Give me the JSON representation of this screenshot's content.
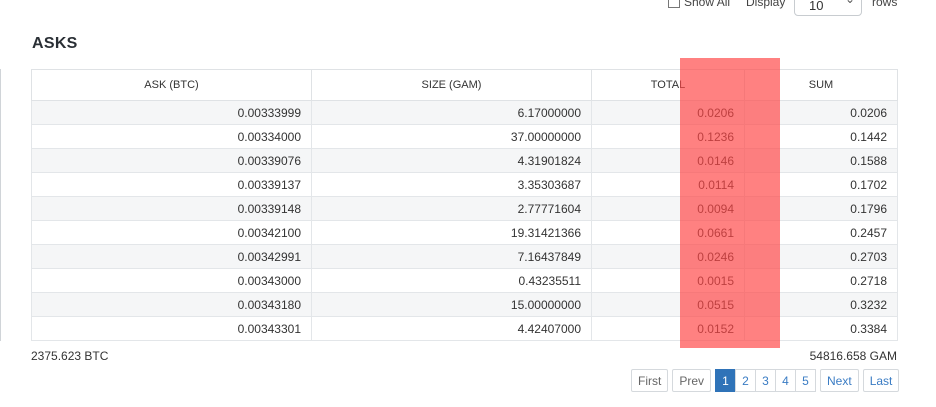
{
  "controls": {
    "show_all_label": "Show All",
    "display_label": "Display",
    "rows_select_value": "10",
    "rows_label": "rows"
  },
  "heading": "ASKS",
  "table": {
    "columns": [
      "ASK (BTC)",
      "SIZE (GAM)",
      "TOTAL",
      "SUM"
    ],
    "rows": [
      [
        "0.00333999",
        "6.17000000",
        "0.0206",
        "0.0206"
      ],
      [
        "0.00334000",
        "37.00000000",
        "0.1236",
        "0.1442"
      ],
      [
        "0.00339076",
        "4.31901824",
        "0.0146",
        "0.1588"
      ],
      [
        "0.00339137",
        "3.35303687",
        "0.0114",
        "0.1702"
      ],
      [
        "0.00339148",
        "2.77771604",
        "0.0094",
        "0.1796"
      ],
      [
        "0.00342100",
        "19.31421366",
        "0.0661",
        "0.2457"
      ],
      [
        "0.00342991",
        "7.16437849",
        "0.0246",
        "0.2703"
      ],
      [
        "0.00343000",
        "0.43235511",
        "0.0015",
        "0.2718"
      ],
      [
        "0.00343180",
        "15.00000000",
        "0.0515",
        "0.3232"
      ],
      [
        "0.00343301",
        "4.42407000",
        "0.0152",
        "0.3384"
      ]
    ]
  },
  "totals": {
    "btc": "2375.623 BTC",
    "gam": "54816.658 GAM"
  },
  "pagination": {
    "first": "First",
    "prev": "Prev",
    "pages": [
      "1",
      "2",
      "3",
      "4",
      "5"
    ],
    "active_page": "1",
    "next": "Next",
    "last": "Last"
  },
  "colors": {
    "highlight_overlay": "#ff4646",
    "active_page_bg": "#2f73b8",
    "link": "#3a7cc4"
  }
}
